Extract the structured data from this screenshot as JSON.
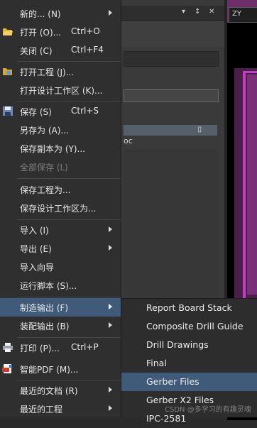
{
  "background": {
    "right_tab_label": "ZY",
    "list_item_fragment": "oc",
    "title_controls": [
      "▾",
      "↕",
      "✕"
    ]
  },
  "menu": {
    "items": [
      {
        "label": "新的... (N)",
        "shortcut": "",
        "submenu": true,
        "icon": ""
      },
      {
        "label": "打开 (O)...",
        "shortcut": "Ctrl+O",
        "submenu": false,
        "icon": "folder-open-icon"
      },
      {
        "label": "关闭 (C)",
        "shortcut": "Ctrl+F4",
        "submenu": false,
        "icon": ""
      },
      {
        "label": "打开工程 (J)...",
        "shortcut": "",
        "submenu": false,
        "icon": "open-project-icon"
      },
      {
        "label": "打开设计工作区 (K)...",
        "shortcut": "",
        "submenu": false,
        "icon": ""
      },
      {
        "label": "保存 (S)",
        "shortcut": "Ctrl+S",
        "submenu": false,
        "icon": "save-icon"
      },
      {
        "label": "另存为 (A)...",
        "shortcut": "",
        "submenu": false,
        "icon": ""
      },
      {
        "label": "保存副本为 (Y)...",
        "shortcut": "",
        "submenu": false,
        "icon": ""
      },
      {
        "label": "全部保存 (L)",
        "shortcut": "",
        "submenu": false,
        "icon": "",
        "disabled": true
      },
      {
        "label": "保存工程为...",
        "shortcut": "",
        "submenu": false,
        "icon": ""
      },
      {
        "label": "保存设计工作区为...",
        "shortcut": "",
        "submenu": false,
        "icon": ""
      },
      {
        "label": "导入 (I)",
        "shortcut": "",
        "submenu": true,
        "icon": ""
      },
      {
        "label": "导出 (E)",
        "shortcut": "",
        "submenu": true,
        "icon": ""
      },
      {
        "label": "导入向导",
        "shortcut": "",
        "submenu": false,
        "icon": ""
      },
      {
        "label": "运行脚本 (S)...",
        "shortcut": "",
        "submenu": false,
        "icon": ""
      },
      {
        "label": "制造输出 (F)",
        "shortcut": "",
        "submenu": true,
        "icon": "",
        "highlighted": true
      },
      {
        "label": "装配输出 (B)",
        "shortcut": "",
        "submenu": true,
        "icon": ""
      },
      {
        "label": "打印 (P)...",
        "shortcut": "Ctrl+P",
        "submenu": false,
        "icon": "printer-icon"
      },
      {
        "label": "智能PDF (M)...",
        "shortcut": "",
        "submenu": false,
        "icon": "pdf-icon"
      },
      {
        "label": "最近的文档 (R)",
        "shortcut": "",
        "submenu": true,
        "icon": ""
      },
      {
        "label": "最近的工程",
        "shortcut": "",
        "submenu": true,
        "icon": ""
      }
    ]
  },
  "submenu": {
    "items": [
      {
        "label": "Report Board Stack"
      },
      {
        "label": "Composite Drill Guide"
      },
      {
        "label": "Drill Drawings"
      },
      {
        "label": "Final"
      },
      {
        "label": "Gerber Files",
        "highlighted": true
      },
      {
        "label": "Gerber X2 Files"
      },
      {
        "label": "IPC-2581"
      }
    ]
  },
  "watermark": "CSDN @多学习的有趣灵魂",
  "colors": {
    "menu_bg": "#2f2f2f",
    "highlight": "#3f5b79",
    "text": "#e8e8e8",
    "disabled_text": "#7d7d7d",
    "accent_right": "#c040c0"
  }
}
